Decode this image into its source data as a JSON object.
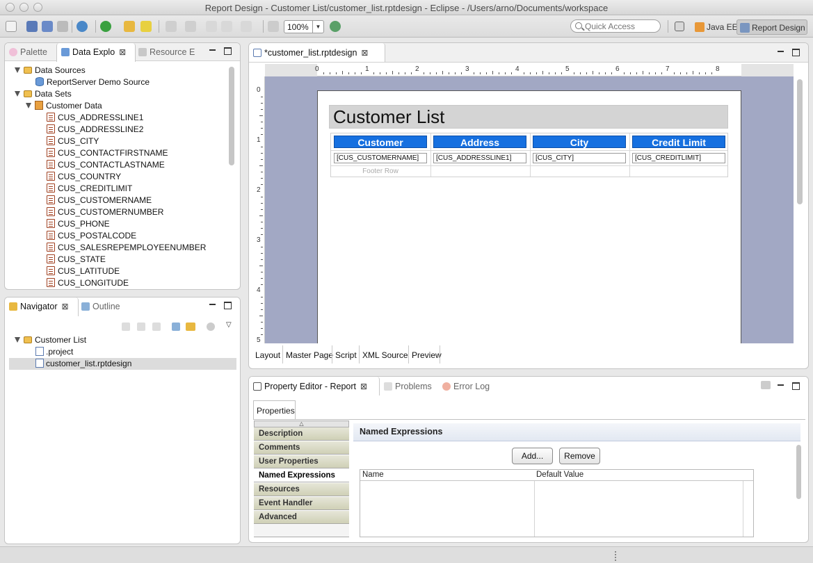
{
  "window": {
    "title": "Report Design - Customer List/customer_list.rptdesign - Eclipse - /Users/arno/Documents/workspace"
  },
  "toolbar": {
    "zoom": "100%",
    "quick_access_placeholder": "Quick Access",
    "perspectives": [
      "Java EE",
      "Report Design"
    ]
  },
  "left_top_panel": {
    "tabs": [
      "Palette",
      "Data Explo",
      "Resource E"
    ],
    "active_tab": "Data Explo",
    "tree": {
      "data_sources_label": "Data Sources",
      "data_source": "ReportServer Demo Source",
      "data_sets_label": "Data Sets",
      "data_set": "Customer Data",
      "columns": [
        "CUS_ADDRESSLINE1",
        "CUS_ADDRESSLINE2",
        "CUS_CITY",
        "CUS_CONTACTFIRSTNAME",
        "CUS_CONTACTLASTNAME",
        "CUS_COUNTRY",
        "CUS_CREDITLIMIT",
        "CUS_CUSTOMERNAME",
        "CUS_CUSTOMERNUMBER",
        "CUS_PHONE",
        "CUS_POSTALCODE",
        "CUS_SALESREPEMPLOYEENUMBER",
        "CUS_STATE",
        "CUS_LATITUDE",
        "CUS_LONGITUDE"
      ]
    }
  },
  "navigator_panel": {
    "tabs": [
      "Navigator",
      "Outline"
    ],
    "active_tab": "Navigator",
    "tree": {
      "project": "Customer List",
      "files": [
        ".project",
        "customer_list.rptdesign"
      ],
      "selected_file": "customer_list.rptdesign"
    }
  },
  "editor": {
    "tab_label": "*customer_list.rptdesign",
    "ruler_h": [
      "0",
      "1",
      "2",
      "3",
      "4",
      "5",
      "6",
      "7",
      "8"
    ],
    "ruler_v": [
      "0",
      "1",
      "2",
      "3",
      "4",
      "5"
    ],
    "report": {
      "title": "Customer List",
      "columns": [
        {
          "header": "Customer",
          "binding": "[CUS_CUSTOMERNAME]"
        },
        {
          "header": "Address",
          "binding": "[CUS_ADDRESSLINE1]"
        },
        {
          "header": "City",
          "binding": "[CUS_CITY]"
        },
        {
          "header": "Credit Limit",
          "binding": "[CUS_CREDITLIMIT]"
        }
      ],
      "footer_label": "Footer Row"
    },
    "bottom_tabs": [
      "Layout",
      "Master Page",
      "Script",
      "XML Source",
      "Preview"
    ],
    "active_bottom_tab": "Layout"
  },
  "property_panel": {
    "tabs": [
      "Property Editor - Report",
      "Problems",
      "Error Log"
    ],
    "active_tab": "Property Editor - Report",
    "properties_tab": "Properties",
    "sidebar": [
      "Description",
      "Comments",
      "User Properties",
      "Named Expressions",
      "Resources",
      "Event Handler",
      "Advanced"
    ],
    "selected": "Named Expressions",
    "section_title": "Named Expressions",
    "add_button": "Add...",
    "remove_button": "Remove",
    "table_headers": [
      "Name",
      "Default Value"
    ]
  },
  "colors": {
    "header_blue": "#1670e0",
    "canvas_bg": "#a2a8c4",
    "title_band": "#d4d4d4"
  }
}
